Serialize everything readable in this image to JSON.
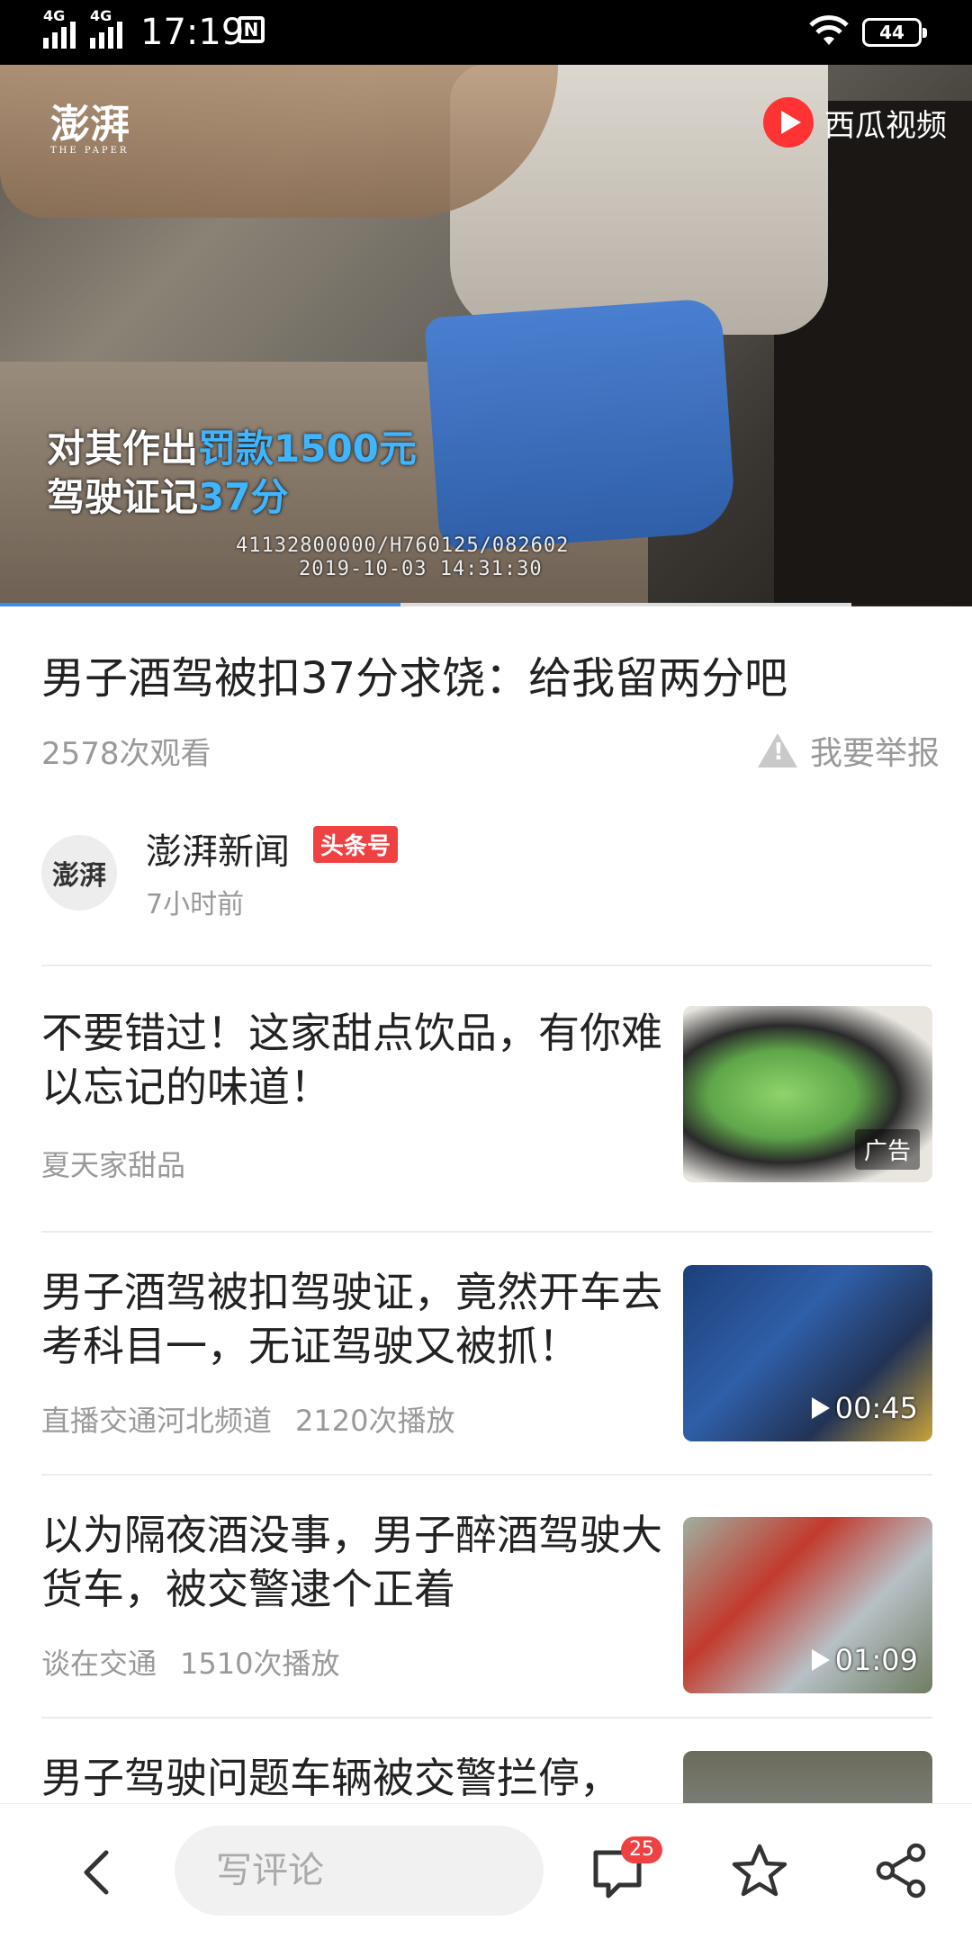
{
  "status_bar": {
    "sim1": "4G",
    "sim2": "4G",
    "time": "17:19",
    "notification_icon": "n-icon",
    "battery": "44"
  },
  "video": {
    "watermark_left": "澎湃",
    "watermark_left_small": "THE PAPER",
    "watermark_right": "西瓜视频",
    "caption_line1_a": "对其作出",
    "caption_line1_b": "罚款1500元",
    "caption_line2_a": "驾驶证记",
    "caption_line2_b": "37分",
    "stamp_line1": "41132800000/H760125/082602",
    "stamp_line2": "2019-10-03  14:31:30",
    "progress": 0.47,
    "accent": "#3d8bf0"
  },
  "article": {
    "title": "男子酒驾被扣37分求饶：给我留两分吧",
    "views": "2578次观看",
    "report_label": "我要举报"
  },
  "author": {
    "avatar_text": "澎湃",
    "name": "澎湃新闻",
    "badge": "头条号",
    "time": "7小时前"
  },
  "feed": [
    {
      "title": "不要错过！这家甜点饮品，有你难以忘记的味道！",
      "source": "夏天家甜品",
      "plays": "",
      "tag": "广告",
      "duration": ""
    },
    {
      "title": "男子酒驾被扣驾驶证，竟然开车去考科目一，无证驾驶又被抓！",
      "source": "直播交通河北频道",
      "plays": "2120次播放",
      "tag": "",
      "duration": "00:45"
    },
    {
      "title": "以为隔夜酒没事，男子醉酒驾驶大货车，被交警逮个正着",
      "source": "谈在交通",
      "plays": "1510次播放",
      "tag": "",
      "duration": "01:09"
    },
    {
      "title": "男子驾驶问题车辆被交警拦停，",
      "source": "",
      "plays": "",
      "tag": "",
      "duration": ""
    }
  ],
  "bottom_bar": {
    "comment_placeholder": "写评论",
    "comment_count": "25",
    "icons": [
      "back-icon",
      "comment-icon",
      "star-icon",
      "share-icon"
    ]
  },
  "colors": {
    "badge_red": "#f04142",
    "text_primary": "#222222",
    "text_secondary": "#999999"
  }
}
